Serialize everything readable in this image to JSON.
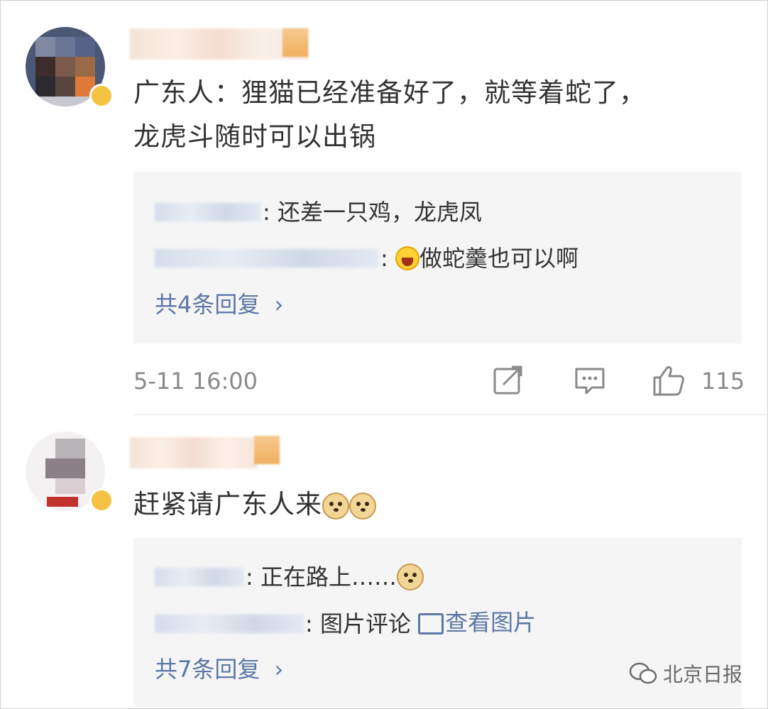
{
  "comments": [
    {
      "text": "广东人：狸猫已经准备好了，就等着蛇了，龙虎斗随时可以出锅",
      "text_line1": "广东人：狸猫已经准备好了，就等着蛇了，",
      "text_line2": "龙虎斗随时可以出锅",
      "replies": [
        {
          "content": ": 还差一只鸡，龙虎凤"
        },
        {
          "content": "做蛇羹也可以啊",
          "emoji": "laughing-emoji"
        }
      ],
      "more_replies": "共4条回复",
      "timestamp": "5-11 16:00",
      "likes": "115"
    },
    {
      "text": "赶紧请广东人来",
      "emojis": [
        "doge-emoji",
        "doge-emoji"
      ],
      "replies": [
        {
          "content": ": 正在路上……",
          "emoji": "doge-emoji"
        },
        {
          "content": ": 图片评论",
          "link": "查看图片"
        }
      ],
      "more_replies": "共7条回复"
    }
  ],
  "watermark": "北京日报",
  "colors": {
    "link": "#5b77a5",
    "reply_bg": "#f5f5f5",
    "meta": "#8a8a8a"
  }
}
